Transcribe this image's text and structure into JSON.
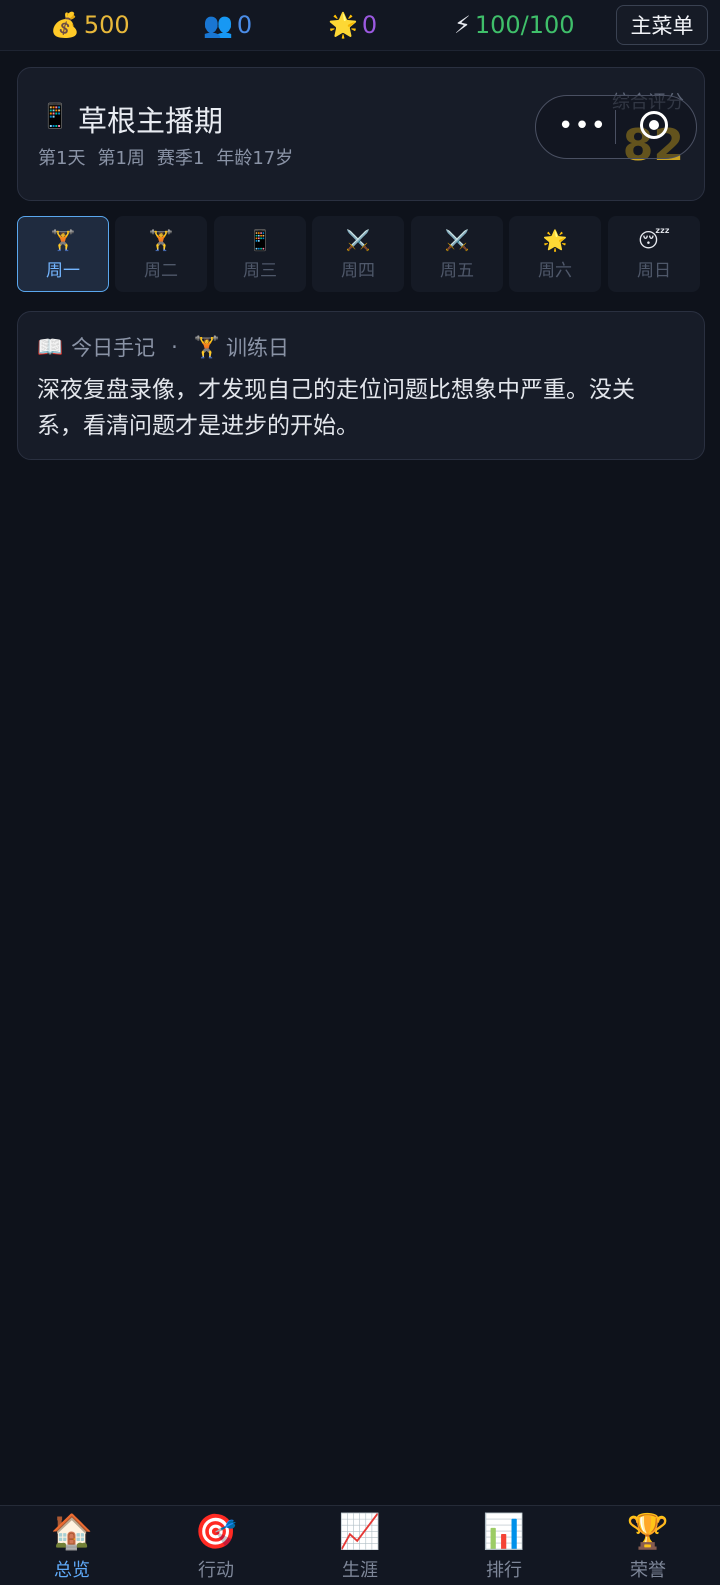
{
  "top_stats": {
    "money": {
      "icon": "💰",
      "value": "500",
      "color": "#e8b83a"
    },
    "fans": {
      "icon": "👥",
      "value": "0",
      "color": "#4b8de8"
    },
    "fame": {
      "icon": "🌟",
      "value": "0",
      "color": "#9b59e0"
    },
    "energy": {
      "icon": "⚡",
      "value": "100/100",
      "color": "#3fbf6a"
    },
    "menu_label": "主菜单"
  },
  "header": {
    "icon": "📱",
    "title": "草根主播期",
    "meta": [
      "第1天",
      "第1周",
      "赛季1",
      "年龄17岁"
    ],
    "score_label": "综合评分",
    "score_value": "82"
  },
  "days": [
    {
      "icon": "🏋️",
      "label": "周一",
      "active": true
    },
    {
      "icon": "🏋️",
      "label": "周二"
    },
    {
      "icon": "📱",
      "label": "周三"
    },
    {
      "icon": "⚔️",
      "label": "周四"
    },
    {
      "icon": "⚔️",
      "label": "周五"
    },
    {
      "icon": "🌟",
      "label": "周六"
    },
    {
      "icon": "😴",
      "label": "周日"
    }
  ],
  "journal": {
    "book_icon": "📖",
    "title": "今日手记",
    "separator": "·",
    "day_icon": "🏋️",
    "day_type": "训练日",
    "text": "深夜复盘录像，才发现自己的走位问题比想象中严重。没关系，看清问题才是进步的开始。"
  },
  "nav": [
    {
      "icon": "🏠",
      "label": "总览",
      "active": true
    },
    {
      "icon": "🎯",
      "label": "行动"
    },
    {
      "icon": "📈",
      "label": "生涯"
    },
    {
      "icon": "📊",
      "label": "排行"
    },
    {
      "icon": "🏆",
      "label": "荣誉"
    }
  ]
}
